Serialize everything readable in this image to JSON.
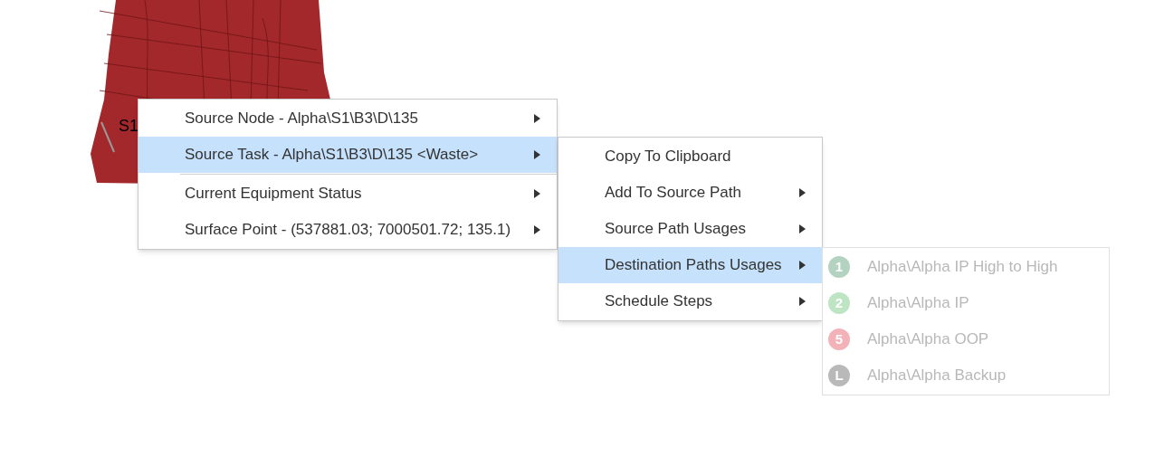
{
  "map": {
    "labels": [
      "S1"
    ]
  },
  "context_menu": {
    "items": [
      {
        "label": "Source Node - Alpha\\S1\\B3\\D\\135",
        "has_submenu": true,
        "selected": false,
        "separator_after": false
      },
      {
        "label": "Source Task - Alpha\\S1\\B3\\D\\135 <Waste>",
        "has_submenu": true,
        "selected": true,
        "separator_after": true
      },
      {
        "label": "Current Equipment Status",
        "has_submenu": true,
        "selected": false,
        "separator_after": false
      },
      {
        "label": "Surface Point - (537881.03; 7000501.72; 135.1)",
        "has_submenu": true,
        "selected": false,
        "separator_after": false
      }
    ]
  },
  "task_submenu": {
    "items": [
      {
        "label": "Copy To Clipboard",
        "has_submenu": false,
        "selected": false
      },
      {
        "label": "Add To Source Path",
        "has_submenu": true,
        "selected": false
      },
      {
        "label": "Source Path Usages",
        "has_submenu": true,
        "selected": false
      },
      {
        "label": "Destination Paths Usages",
        "has_submenu": true,
        "selected": true
      },
      {
        "label": "Schedule Steps",
        "has_submenu": true,
        "selected": false
      }
    ]
  },
  "paths_submenu": {
    "items": [
      {
        "badge": "1",
        "color": "#b3d3c0",
        "label": "Alpha\\Alpha IP High to High",
        "disabled": true
      },
      {
        "badge": "2",
        "color": "#bde5c3",
        "label": "Alpha\\Alpha IP",
        "disabled": true
      },
      {
        "badge": "5",
        "color": "#f2b2b7",
        "label": "Alpha\\Alpha OOP",
        "disabled": true
      },
      {
        "badge": "L",
        "color": "#b9b9b9",
        "label": "Alpha\\Alpha Backup",
        "disabled": true
      }
    ]
  }
}
